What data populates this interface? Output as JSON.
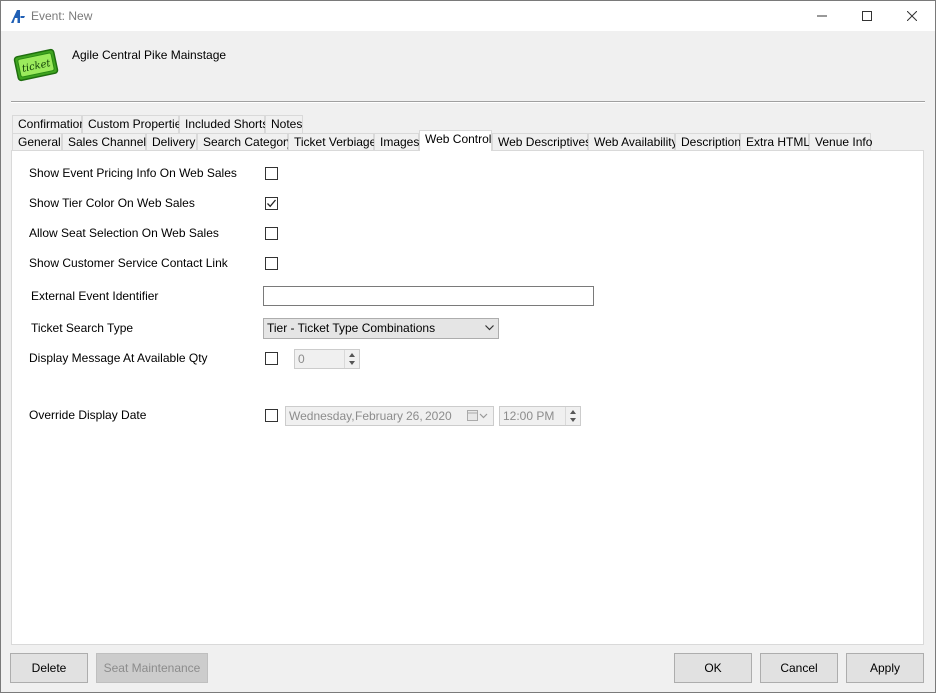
{
  "window": {
    "title": "Event: New",
    "controls": {
      "minimize": "minimize",
      "maximize": "maximize",
      "close": "close"
    }
  },
  "header": {
    "event_name": "Agile Central Pike Mainstage",
    "icon": "ticket-icon",
    "icon_text": "ticket"
  },
  "tabs": {
    "row1": [
      {
        "label": "Confirmation"
      },
      {
        "label": "Custom Properties"
      },
      {
        "label": "Included Shorts"
      },
      {
        "label": "Notes"
      }
    ],
    "row2": [
      {
        "label": "General"
      },
      {
        "label": "Sales Channels"
      },
      {
        "label": "Delivery"
      },
      {
        "label": "Search Category"
      },
      {
        "label": "Ticket Verbiage"
      },
      {
        "label": "Images"
      },
      {
        "label": "Web Control",
        "active": true
      },
      {
        "label": "Web Descriptives"
      },
      {
        "label": "Web Availability"
      },
      {
        "label": "Description"
      },
      {
        "label": "Extra HTML"
      },
      {
        "label": "Venue Info"
      }
    ]
  },
  "web_control": {
    "show_pricing_info": {
      "label": "Show Event Pricing Info On Web Sales",
      "checked": false
    },
    "show_tier_color": {
      "label": "Show Tier Color On Web Sales",
      "checked": true
    },
    "allow_seat_selection": {
      "label": "Allow Seat Selection On Web Sales",
      "checked": false
    },
    "show_cs_link": {
      "label": "Show Customer Service Contact Link",
      "checked": false
    },
    "external_event_identifier": {
      "label": "External Event Identifier",
      "value": ""
    },
    "ticket_search_type": {
      "label": "Ticket Search Type",
      "value": "Tier - Ticket Type Combinations"
    },
    "display_message_qty": {
      "label": "Display Message At Available Qty",
      "checked": false,
      "value": "0"
    },
    "override_display_date": {
      "label": "Override Display Date",
      "checked": false,
      "weekday": "Wednesday,",
      "month": "February",
      "day": "26,",
      "year": "2020",
      "time": "12:00 PM"
    }
  },
  "footer": {
    "delete": "Delete",
    "seat_maintenance": "Seat Maintenance",
    "ok": "OK",
    "cancel": "Cancel",
    "apply": "Apply"
  }
}
